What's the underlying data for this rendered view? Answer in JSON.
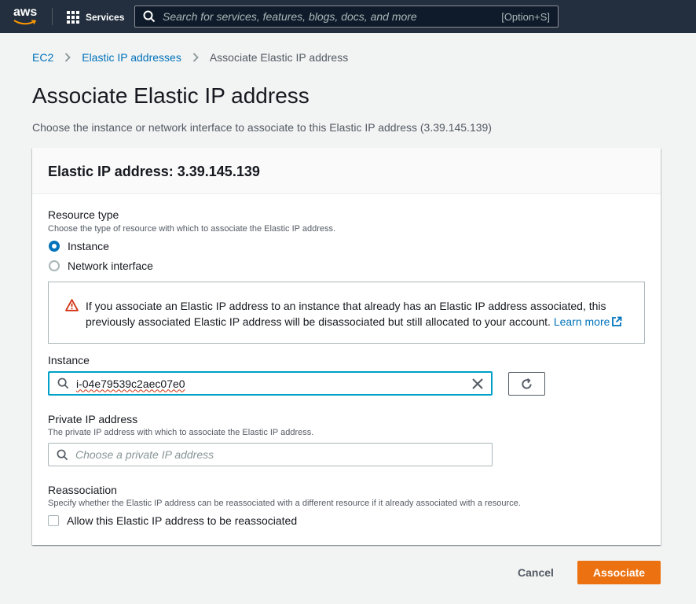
{
  "nav": {
    "logo": "aws",
    "services_label": "Services",
    "search_placeholder": "Search for services, features, blogs, docs, and more",
    "search_shortcut": "[Option+S]"
  },
  "breadcrumb": {
    "items": [
      "EC2",
      "Elastic IP addresses"
    ],
    "current": "Associate Elastic IP address"
  },
  "page": {
    "title": "Associate Elastic IP address",
    "description": "Choose the instance or network interface to associate to this Elastic IP address (3.39.145.139)"
  },
  "panel": {
    "header": "Elastic IP address: 3.39.145.139",
    "resource_type": {
      "label": "Resource type",
      "hint": "Choose the type of resource with which to associate the Elastic IP address.",
      "options": [
        "Instance",
        "Network interface"
      ],
      "selected": "Instance"
    },
    "alert": {
      "message": "If you associate an Elastic IP address to an instance that already has an Elastic IP address associated, this previously associated Elastic IP address will be disassociated but still allocated to your account.",
      "link": "Learn more"
    },
    "instance": {
      "label": "Instance",
      "value": "i-04e79539c2aec07e0"
    },
    "private_ip": {
      "label": "Private IP address",
      "hint": "The private IP address with which to associate the Elastic IP address.",
      "placeholder": "Choose a private IP address"
    },
    "reassociation": {
      "label": "Reassociation",
      "hint": "Specify whether the Elastic IP address can be reassociated with a different resource if it already associated with a resource.",
      "checkbox_label": "Allow this Elastic IP address to be reassociated",
      "checked": false
    }
  },
  "actions": {
    "cancel": "Cancel",
    "primary": "Associate"
  },
  "colors": {
    "nav_bg": "#232f3e",
    "link": "#0073bb",
    "primary": "#ec7211",
    "focus": "#00a1c9",
    "warning": "#d13212"
  }
}
